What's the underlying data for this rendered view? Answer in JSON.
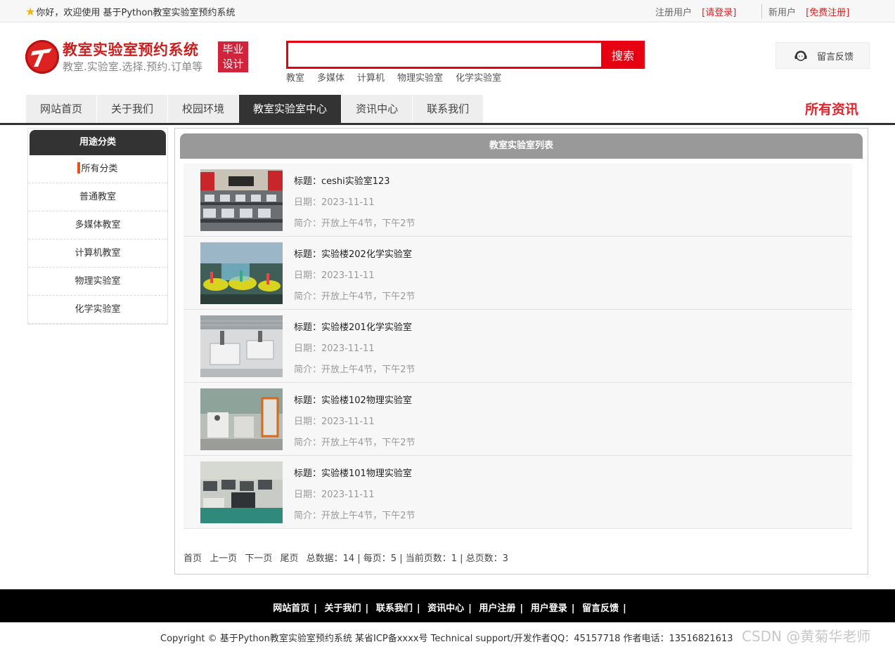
{
  "topbar": {
    "welcome": "你好，欢迎使用 基于Python教室实验室预约系统",
    "registered_label": "注册用户",
    "login_link": "[请登录]",
    "new_user_label": "新用户",
    "register_link": "[免费注册]"
  },
  "header": {
    "title": "教室实验室预约系统",
    "subtitle": "教室.实验室.选择.预约.订单等",
    "badge_line1": "毕业",
    "badge_line2": "设计",
    "search_placeholder": "",
    "search_button": "搜索",
    "hot_words": [
      "教室",
      "多媒体",
      "计算机",
      "物理实验室",
      "化学实验室"
    ],
    "feedback": "留言反馈"
  },
  "nav": {
    "tabs": [
      {
        "label": "网站首页",
        "active": false
      },
      {
        "label": "关于我们",
        "active": false
      },
      {
        "label": "校园环境",
        "active": false
      },
      {
        "label": "教室实验室中心",
        "active": true
      },
      {
        "label": "资讯中心",
        "active": false
      },
      {
        "label": "联系我们",
        "active": false
      }
    ],
    "right_title": "所有资讯"
  },
  "sidebar": {
    "title": "用途分类",
    "items": [
      "所有分类",
      "普通教室",
      "多媒体教室",
      "计算机教室",
      "物理实验室",
      "化学实验室"
    ]
  },
  "main": {
    "title": "教室实验室列表",
    "rows": [
      {
        "title": "标题：ceshi实验室123",
        "date": "日期：2023-11-11",
        "intro": "简介：开放上午4节，下午2节",
        "image": "computer-lab-photo"
      },
      {
        "title": "标题：实验楼202化学实验室",
        "date": "日期：2023-11-11",
        "intro": "简介：开放上午4节，下午2节",
        "image": "chemistry-lab-photo"
      },
      {
        "title": "标题：实验楼201化学实验室",
        "date": "日期：2023-11-11",
        "intro": "简介：开放上午4节，下午2节",
        "image": "chemistry-lab-photo"
      },
      {
        "title": "标题：实验楼102物理实验室",
        "date": "日期：2023-11-11",
        "intro": "简介：开放上午4节，下午2节",
        "image": "physics-lab-photo"
      },
      {
        "title": "标题：实验楼101物理实验室",
        "date": "日期：2023-11-11",
        "intro": "简介：开放上午4节，下午2节",
        "image": "physics-lab-photo"
      }
    ],
    "pager": {
      "first": "首页",
      "prev": "上一页",
      "next": "下一页",
      "last": "尾页",
      "info": "总数据：14 | 每页：5 | 当前页数：1 | 总页数：3"
    }
  },
  "footer": {
    "links": [
      "网站首页",
      "关于我们",
      "联系我们",
      "资讯中心",
      "用户注册",
      "用户登录",
      "留言反馈"
    ],
    "copyright": "Copyright © 基于Python教室实验室预约系统 某省ICP备xxxx号    Technical support/开发作者QQ：45157718     作者电话：13516821613",
    "watermark": "CSDN @黄菊华老师"
  },
  "colors": {
    "brand_red": "#e60012",
    "nav_dark": "#333333",
    "title_red": "#cc1f1f"
  }
}
